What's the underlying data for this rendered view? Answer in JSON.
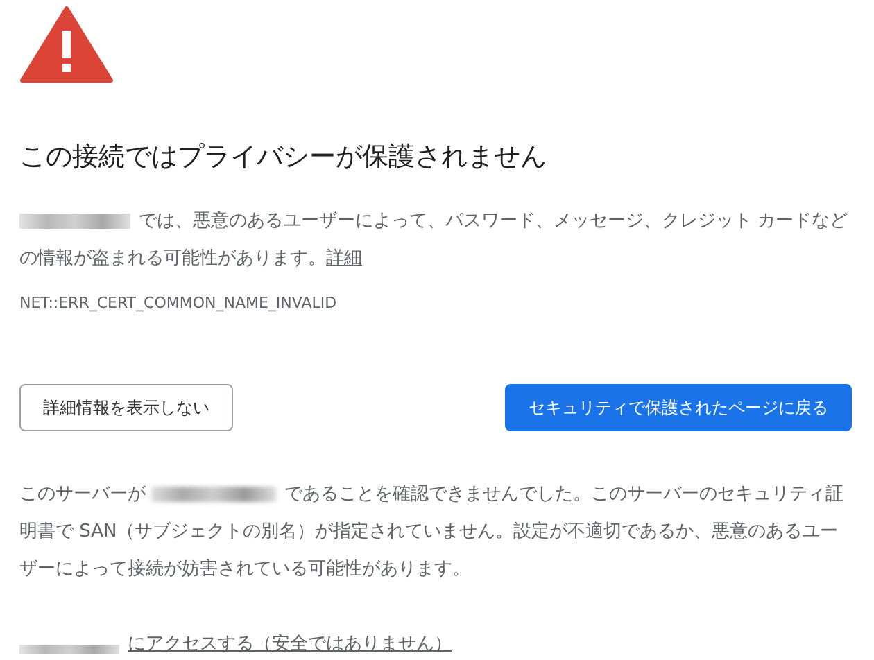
{
  "heading": "この接続ではプライバシーが保護されません",
  "description": {
    "text": "では、悪意のあるユーザーによって、パスワード、メッセージ、クレジット カードなどの情報が盗まれる可能性があります。",
    "link": "詳細"
  },
  "error_code": "NET::ERR_CERT_COMMON_NAME_INVALID",
  "buttons": [
    {
      "label": "詳細情報を表示しない",
      "kind": "secondary"
    },
    {
      "label": "セキュリティで保護されたページに戻る",
      "kind": "primary"
    }
  ],
  "details": {
    "before": "このサーバーが",
    "after": "であることを確認できませんでした。このサーバーのセキュリティ証明書で SAN（サブジェクトの別名）が指定されていません。設定が不適切であるか、悪意のあるユーザーによって接続が妨害されている可能性があります。"
  },
  "proceed_link": "にアクセスする（安全ではありません）"
}
